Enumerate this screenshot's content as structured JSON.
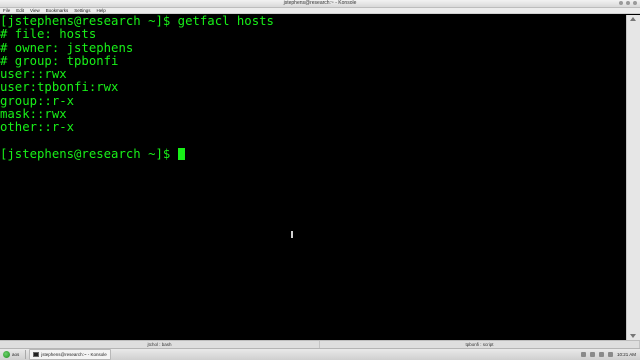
{
  "window": {
    "title": "jstephens@research:~ - Konsole"
  },
  "menubar": {
    "items": [
      "File",
      "Edit",
      "View",
      "Bookmarks",
      "Settings",
      "Help"
    ]
  },
  "terminal": {
    "lines": [
      "[jstephens@research ~]$ getfacl hosts",
      "# file: hosts",
      "# owner: jstephens",
      "# group: tpbonfi",
      "user::rwx",
      "user:tpbonfi:rwx",
      "group::r-x",
      "mask::rwx",
      "other::r-x",
      "",
      "[jstephens@research ~]$ "
    ],
    "text_color": "#18f018",
    "background": "#000000"
  },
  "tabs": [
    {
      "label": "jtchol : bash",
      "active": false
    },
    {
      "label": "tpbonfi : script",
      "active": false
    }
  ],
  "taskbar": {
    "start_label": "aos",
    "task_label": "jstephens@research:~ - Konsole",
    "clock": "10:21 AM"
  }
}
